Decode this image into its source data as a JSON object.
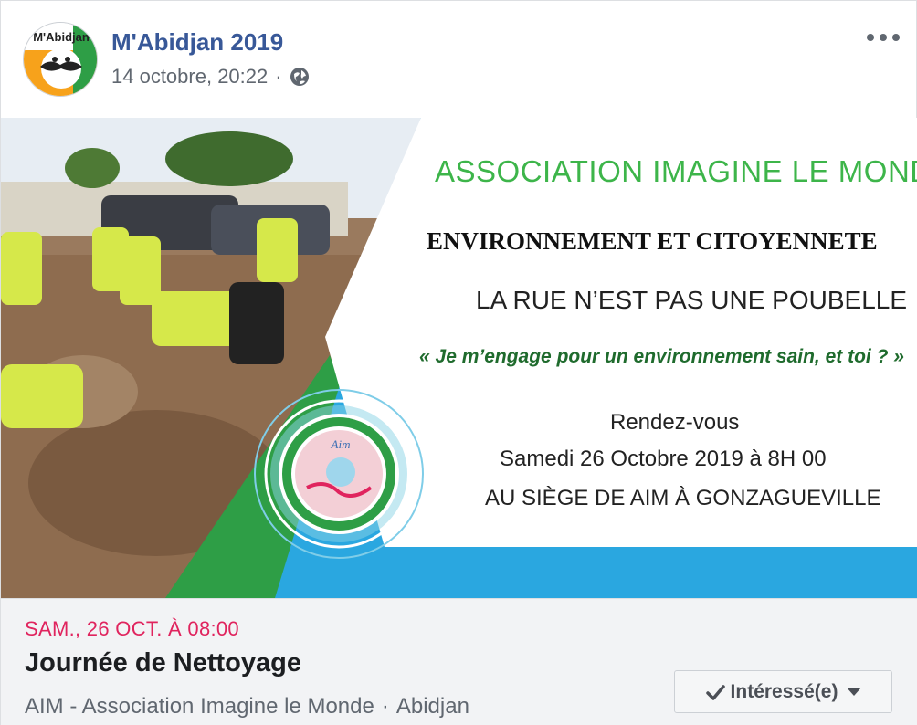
{
  "post": {
    "page_name": "M'Abidjan 2019",
    "timestamp": "14 octobre, 20:22",
    "separator": "·",
    "privacy_icon": "globe-icon",
    "more_icon": "more-options-icon",
    "avatar_text": "M'Abidjan"
  },
  "banner": {
    "association": "ASSOCIATION IMAGINE LE MONDE",
    "theme": "ENVIRONNEMENT ET CITOYENNETE",
    "headline": "LA RUE N’EST PAS UNE POUBELLE",
    "slogan": "« Je m’engage pour un environnement sain, et toi ? »",
    "rendezvous": "Rendez-vous",
    "date_line": "Samedi 26 Octobre  2019 à 8H 00",
    "location_line": "AU SIÈGE DE AIM À GONZAGUEVILLE",
    "logo_text": "Aim"
  },
  "event": {
    "date": "SAM., 26 OCT. À 08:00",
    "title": "Journée de Nettoyage",
    "organizer": "AIM - Association Imagine le Monde",
    "separator": "·",
    "city": "Abidjan",
    "interest_button": "Intéressé(e)"
  },
  "colors": {
    "link_blue": "#385898",
    "event_red": "#e0245e",
    "banner_green": "#3db54a",
    "banner_blue": "#2aa7e0"
  }
}
